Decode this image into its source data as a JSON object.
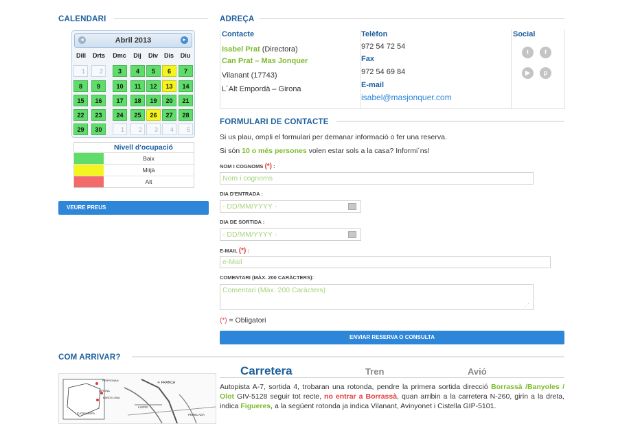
{
  "calendar_section": {
    "title": "CALENDARI"
  },
  "calendar": {
    "month": "Abril 2013",
    "prev": "◄",
    "next": "►",
    "weekdays": [
      "Dill",
      "Drts",
      "Dmc",
      "Dij",
      "Div",
      "Dis",
      "Diu"
    ],
    "weeks": [
      [
        "1",
        "2",
        "3",
        "4",
        "5",
        "6",
        "7"
      ],
      [
        "8",
        "9",
        "10",
        "11",
        "12",
        "13",
        "14"
      ],
      [
        "15",
        "16",
        "17",
        "18",
        "19",
        "20",
        "21"
      ],
      [
        "22",
        "23",
        "24",
        "25",
        "26",
        "27",
        "28"
      ],
      [
        "29",
        "30",
        "1",
        "2",
        "3",
        "4",
        "5"
      ]
    ]
  },
  "legend": {
    "title": "Nivell d'ocupació",
    "items": [
      {
        "label": "Baix",
        "color": "#5fdc6a"
      },
      {
        "label": "Mitjà",
        "color": "#f3f51c"
      },
      {
        "label": "Alt",
        "color": "#f36a6a"
      }
    ]
  },
  "prices_button": "VEURE PREUS",
  "address": {
    "title": "ADREÇA",
    "contact_header": "Contacte",
    "name": "Isabel Prat",
    "role": " (Directora)",
    "house": "Can Prat – Mas Jonquer",
    "city": "Vilanant (17743)",
    "region": "L´Alt Empordà – Girona",
    "phone_header": "Telèfon",
    "phone": "972 54 72 54",
    "fax_header": "Fax",
    "fax": "972 54 69 84",
    "email_header": "E-mail",
    "email": "isabel@masjonquer.com",
    "social_header": "Social"
  },
  "social_icons": [
    "twitter-icon",
    "facebook-icon",
    "youtube-icon",
    "pinterest-icon"
  ],
  "form": {
    "title": "FORMULARI DE CONTACTE",
    "intro": "Si us plau, ompli el formulari per demanar informació o fer una reserva.",
    "note_pre": "Si són ",
    "note_highlight": "10 o més persones",
    "note_post": " volen estar sols a la casa? Informi´ns!",
    "name_label": "NOM I COGNOMS",
    "name_placeholder": "Nom i cognoms",
    "arrival_label": "DIA D'ENTRADA :",
    "arrival_placeholder": "- DD/MM/YYYY -",
    "departure_label": "DIA DE SORTIDA :",
    "departure_placeholder": "- DD/MM/YYYY -",
    "email_label": "E-MAIL",
    "email_placeholder": "e-Mail",
    "comment_label": "COMENTARI (MÀX. 200 CARÀCTERS):",
    "comment_placeholder": "Comentari (Màx. 200 Caràcters)",
    "req_mark": "(*)",
    "colon": " :",
    "required_note": " = Obligatori",
    "submit": "ENVIAR RESERVA O CONSULTA"
  },
  "directions": {
    "title": "COM ARRIVAR?",
    "tabs": [
      "Carretera",
      "Tren",
      "Avió"
    ],
    "text_1": "Autopista A-7, sortida 4, trobaran una rotonda, pendre la primera sortida direcció ",
    "text_green_1": "Borrassà /Banyoles / Olot",
    "text_2": " GIV-5128 seguir tot recte, ",
    "text_red": "no entrar a Borrassà",
    "text_3": ", quan arribin a la carretera N-260, girin a la dreta, indica ",
    "text_green_2": "Figueres",
    "text_4": ", a la següent rotonda ja indica Vilanant, Avinyonet i Cistella GIP-5101."
  },
  "map": {
    "labels": [
      "PERPIGNAN",
      "GIRONA",
      "BARCELONA",
      "CATALUNYA",
      "✈ FRANÇA",
      "LLERS",
      "PERELADA"
    ]
  }
}
